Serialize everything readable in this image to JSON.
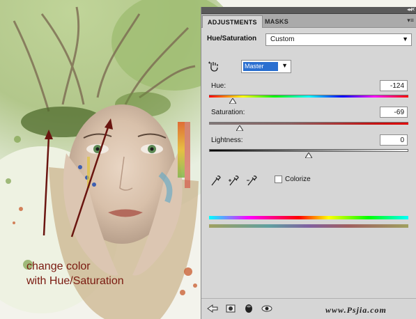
{
  "artwork": {
    "caption_lines": [
      "change color",
      "with Hue/Saturation"
    ],
    "caption_color": "#7a1a10"
  },
  "panel": {
    "tabs": [
      {
        "label": "ADJUSTMENTS",
        "active": true
      },
      {
        "label": "MASKS",
        "active": false
      }
    ],
    "title": "Hue/Saturation",
    "preset": "Custom",
    "channel": "Master",
    "sliders": [
      {
        "label": "Hue:",
        "value": "-124",
        "position": 0.12
      },
      {
        "label": "Saturation:",
        "value": "-69",
        "position": 0.155
      },
      {
        "label": "Lightness:",
        "value": "0",
        "position": 0.5
      }
    ],
    "colorize_label": "Colorize",
    "colorize_checked": false,
    "icons": {
      "hand": "on-image-adjust-icon",
      "eyedroppers": [
        "eyedropper-icon",
        "eyedropper-plus-icon",
        "eyedropper-minus-icon"
      ],
      "bottom": [
        "back-arrow-icon",
        "clip-to-layer-icon",
        "layer-mask-icon",
        "visibility-icon"
      ]
    },
    "watermark": "www.Psjia.com"
  }
}
